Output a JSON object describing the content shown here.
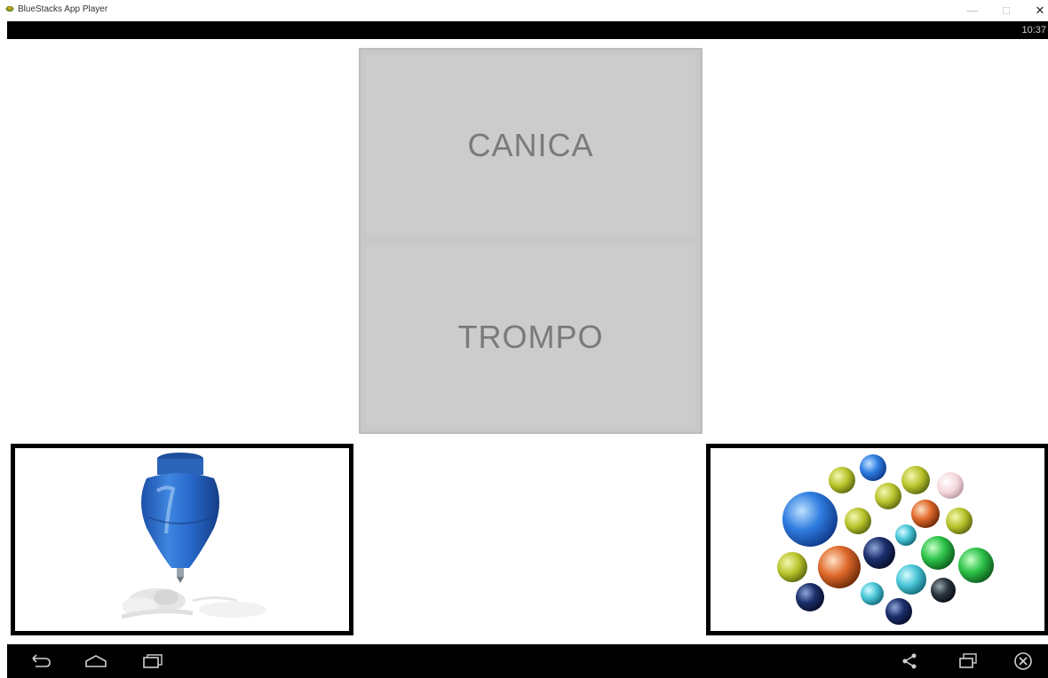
{
  "window": {
    "title": "BlueStacks App Player"
  },
  "status_bar": {
    "time": "10:37"
  },
  "game": {
    "words": [
      {
        "label": "CANICA"
      },
      {
        "label": "TROMPO"
      }
    ],
    "cards": [
      {
        "icon": "spinning-top-image"
      },
      {
        "icon": "marbles-image"
      }
    ]
  },
  "nav_bar": {
    "left": [
      "back-icon",
      "home-icon",
      "recent-apps-icon"
    ],
    "right": [
      "share-icon",
      "rotate-icon",
      "close-circle-icon"
    ]
  },
  "colors": {
    "word_panel_bg": "#cccccc",
    "word_text": "#7a7a7a",
    "card_border": "#000000",
    "system_bar": "#000000"
  }
}
